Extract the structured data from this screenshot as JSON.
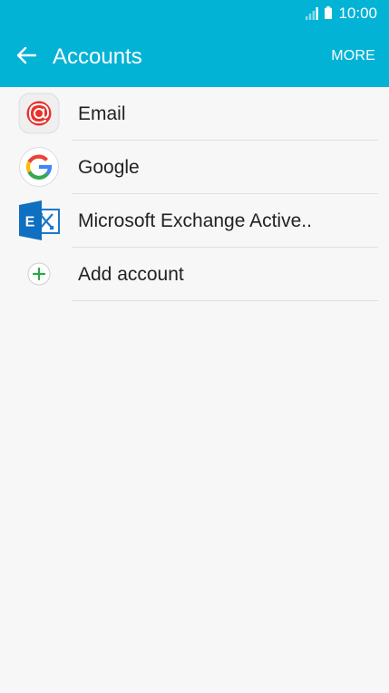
{
  "status_bar": {
    "time": "10:00"
  },
  "header": {
    "title": "Accounts",
    "more_label": "MORE"
  },
  "accounts": [
    {
      "label": "Email",
      "icon": "email-icon"
    },
    {
      "label": "Google",
      "icon": "google-icon"
    },
    {
      "label": "Microsoft Exchange Active..",
      "icon": "exchange-icon"
    },
    {
      "label": "Add account",
      "icon": "add-icon"
    }
  ],
  "colors": {
    "header_bg": "#03b3d6",
    "background": "#f7f7f7",
    "email_red": "#e8322d",
    "exchange_blue": "#0f6fc0",
    "add_green": "#2fa54a"
  }
}
